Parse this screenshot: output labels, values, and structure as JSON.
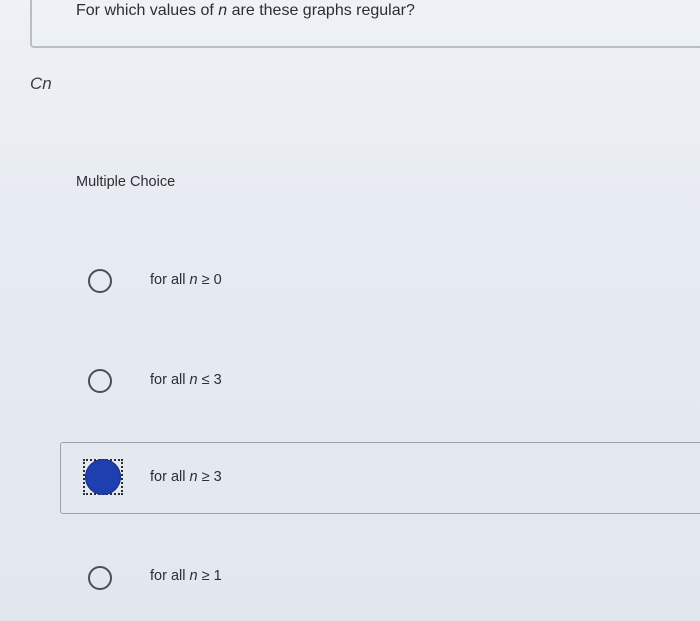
{
  "question": {
    "prefix": "For which values of ",
    "variable": "n",
    "suffix": " are these graphs regular?"
  },
  "graph_label": "Cn",
  "multiple_choice_heading": "Multiple Choice",
  "options": [
    {
      "prefix": "for all ",
      "variable": "n",
      "relation": "≥ 0",
      "selected": false
    },
    {
      "prefix": "for all ",
      "variable": "n",
      "relation": "≤ 3",
      "selected": false
    },
    {
      "prefix": "for all ",
      "variable": "n",
      "relation": "≥ 3",
      "selected": true
    },
    {
      "prefix": "for all ",
      "variable": "n",
      "relation": "≥ 1",
      "selected": false
    }
  ],
  "colors": {
    "selected_radio": "#1e3fae",
    "border": "#b8bec6"
  }
}
